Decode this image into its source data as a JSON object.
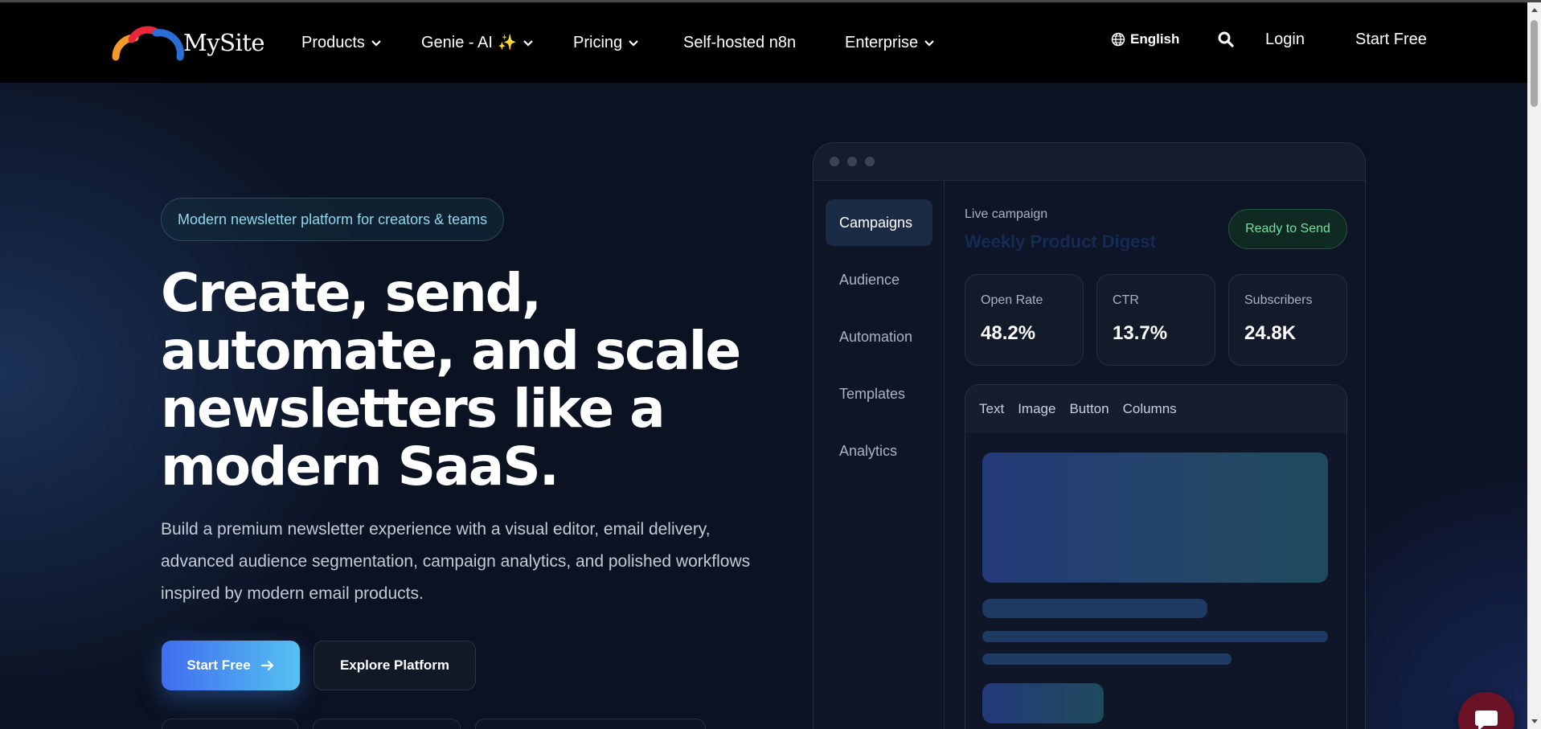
{
  "nav": {
    "logo_text": "MySite",
    "items": [
      {
        "label": "Products",
        "dropdown": true
      },
      {
        "label": "Genie - AI",
        "sparkle": "✨",
        "dropdown": true
      },
      {
        "label": "Pricing",
        "dropdown": true
      },
      {
        "label": "Self-hosted n8n",
        "dropdown": false
      },
      {
        "label": "Enterprise",
        "dropdown": true
      }
    ],
    "language": "English",
    "login": "Login",
    "start_free": "Start Free"
  },
  "hero": {
    "badge": "Modern newsletter platform for creators & teams",
    "headline": "Create, send, automate, and scale newsletters like a modern SaaS.",
    "subtext": "Build a premium newsletter experience with a visual editor, email delivery, advanced audience segmentation, campaign analytics, and polished workflows inspired by modern email products.",
    "primary_button": "Start Free",
    "secondary_button": "Explore Platform"
  },
  "mockup": {
    "sidebar": [
      "Campaigns",
      "Audience",
      "Automation",
      "Templates",
      "Analytics"
    ],
    "active_item": "Campaigns",
    "live_label": "Live campaign",
    "campaign_title": "Weekly Product Digest",
    "status_badge": "Ready to Send",
    "stats": [
      {
        "label": "Open Rate",
        "value": "48.2%"
      },
      {
        "label": "CTR",
        "value": "13.7%"
      },
      {
        "label": "Subscribers",
        "value": "24.8K"
      }
    ],
    "editor_tools": [
      "Text",
      "Image",
      "Button",
      "Columns"
    ]
  },
  "colors": {
    "page_bg": "#0b1222",
    "nav_bg": "#000000",
    "accent_start": "#3f6cf0",
    "accent_end": "#55c2f0",
    "badge_text": "#8fd8ee",
    "ready_text": "#6fe0a3",
    "chat_bg": "#6b1226"
  },
  "icons": {
    "logo": "rainbow-arc-logo",
    "language": "globe-icon",
    "search": "search-icon",
    "button_arrow": "arrow-right-icon",
    "chat": "chat-bubble-icon",
    "dropdown": "chevron-down-icon"
  }
}
